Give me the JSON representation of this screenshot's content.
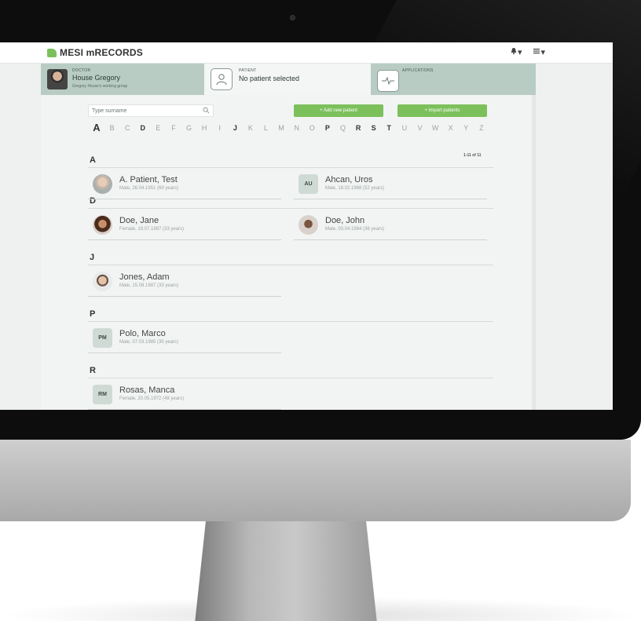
{
  "app": {
    "logo_text": "MESI mRECORDS",
    "notification_icon": "bell-icon",
    "menu_icon": "hamburger-menu-icon",
    "notification_label": "▾",
    "menu_label": "▾"
  },
  "context": {
    "doctor": {
      "caption": "DOCTOR",
      "name": "House Gregory",
      "group": "Gregory House's working group"
    },
    "patient": {
      "caption": "PATIENT",
      "status": "No patient selected"
    },
    "applications": {
      "caption": "APPLICATIONS"
    }
  },
  "toolbar": {
    "search_placeholder": "Type surname",
    "add_label": "+ Add new patient",
    "import_label": "+ Import patients"
  },
  "alphabet": [
    "A",
    "B",
    "C",
    "D",
    "E",
    "F",
    "G",
    "H",
    "I",
    "J",
    "K",
    "L",
    "M",
    "N",
    "O",
    "P",
    "Q",
    "R",
    "S",
    "T",
    "U",
    "V",
    "W",
    "X",
    "Y",
    "Z"
  ],
  "alphabet_active": [
    "A",
    "D",
    "J",
    "P",
    "R",
    "S",
    "T"
  ],
  "counter": "1-11 of 11",
  "groups": [
    {
      "letter": "A"
    },
    {
      "letter": "D"
    },
    {
      "letter": "J"
    },
    {
      "letter": "P"
    },
    {
      "letter": "R"
    }
  ],
  "patients": [
    {
      "name": "A. Patient, Test",
      "info": "Male, 26.04.1951 (69 years)",
      "initials": "",
      "photo": true
    },
    {
      "name": "Ahcan, Uros",
      "info": "Male, 18.02.1968 (52 years)",
      "initials": "AU",
      "photo": false
    },
    {
      "name": "Doe, Jane",
      "info": "Female, 19.07.1987 (33 years)",
      "initials": "",
      "photo": true
    },
    {
      "name": "Doe, John",
      "info": "Male, 03.04.1984 (36 years)",
      "initials": "",
      "photo": true
    },
    {
      "name": "Jones, Adam",
      "info": "Male, 15.08.1987 (33 years)",
      "initials": "",
      "photo": true
    },
    {
      "name": "Polo, Marco",
      "info": "Male, 07.03.1985 (35 years)",
      "initials": "PM",
      "photo": false
    },
    {
      "name": "Rosas, Manca",
      "info": "Female, 20.05.1972 (48 years)",
      "initials": "RM",
      "photo": false
    }
  ],
  "colors": {
    "accent": "#7cc05b",
    "context_bar": "#b8ccc4",
    "panel": "#f2f4f3"
  }
}
